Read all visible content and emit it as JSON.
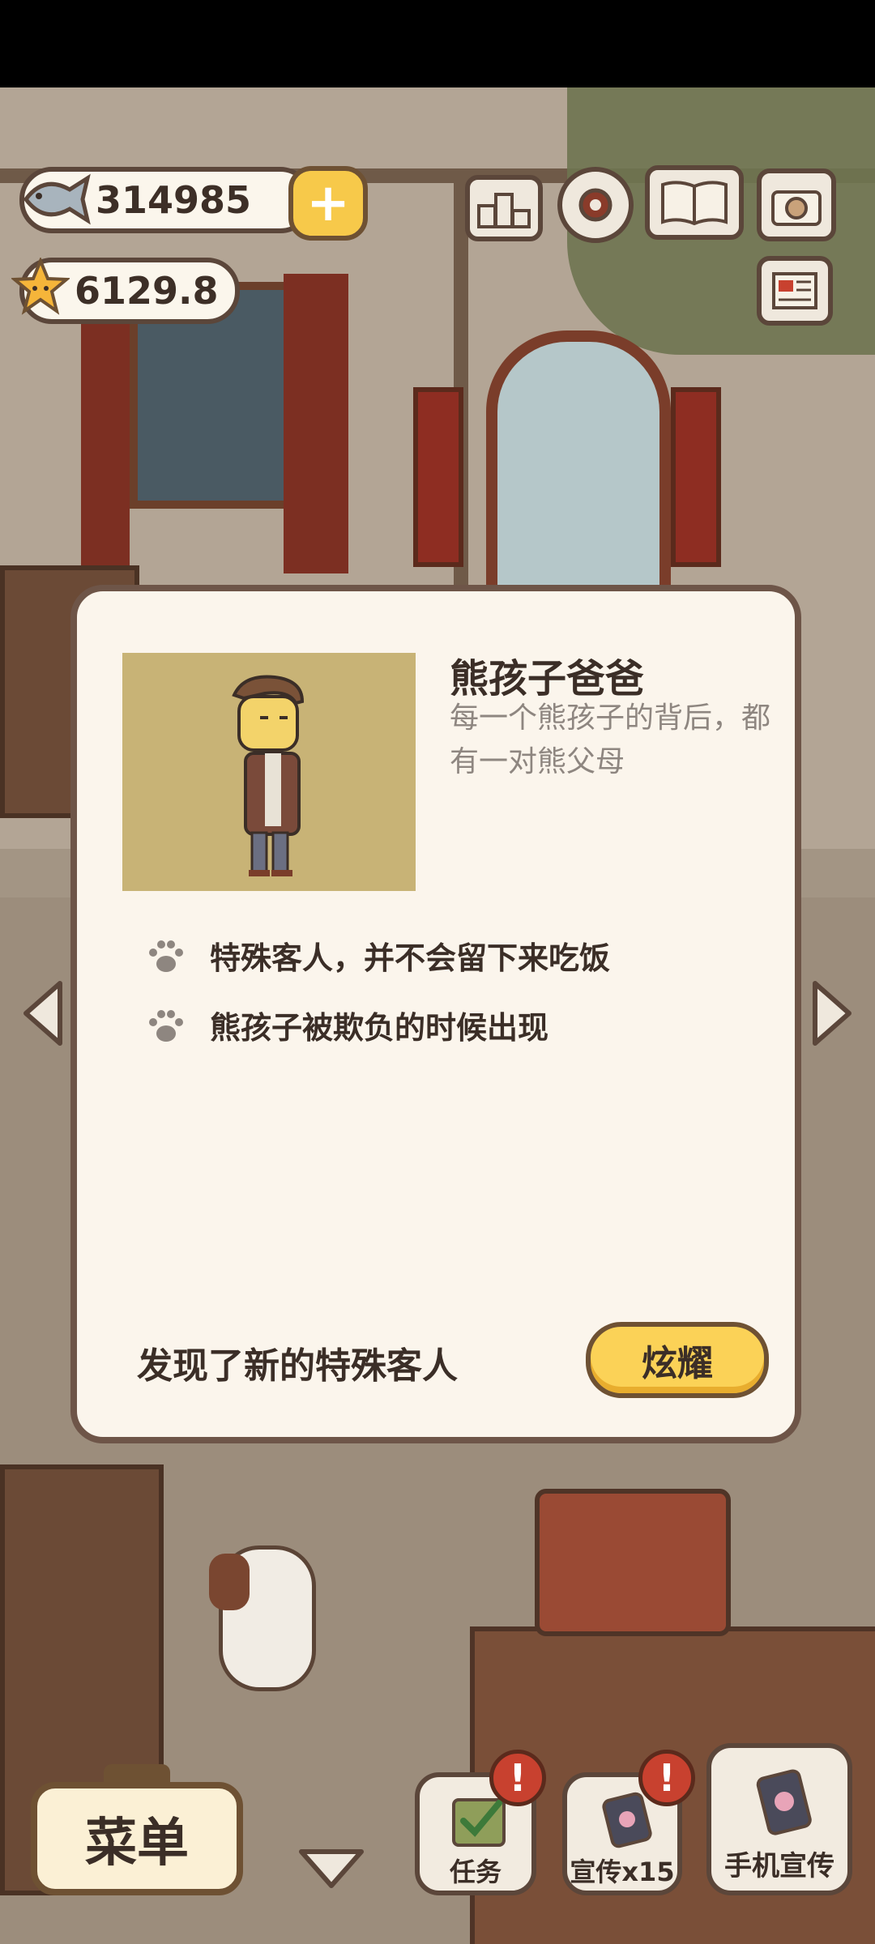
{
  "hud": {
    "fish_count": "314985",
    "star_count": "6129.8",
    "icons": [
      "fish-icon",
      "plus-icon",
      "star-icon",
      "ranking-icon",
      "gear-icon",
      "book-icon",
      "camera-icon",
      "newspaper-icon"
    ]
  },
  "dialog": {
    "title": "熊孩子爸爸",
    "description": "每一个熊孩子的背后，都有一对熊父母",
    "bullets": [
      "特殊客人，并不会留下来吃饭",
      "熊孩子被欺负的时候出现"
    ],
    "footer_text": "发现了新的特殊客人",
    "show_button": "炫耀"
  },
  "bottom_bar": {
    "menu_label": "菜单",
    "tasks_label": "任务",
    "promo_label": "宣传x15",
    "phone_promo_label": "手机宣传",
    "alert_mark": "!"
  },
  "colors": {
    "accent_yellow": "#fbd257",
    "dialog_bg": "#fbf5ec",
    "border_brown": "#6e5548",
    "alert_red": "#c8412f"
  }
}
